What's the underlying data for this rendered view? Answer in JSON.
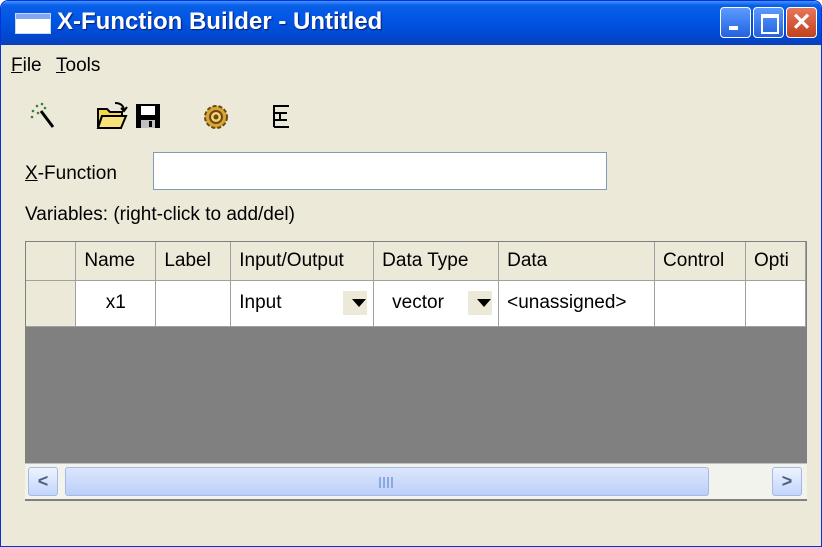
{
  "window": {
    "title": "X-Function Builder - Untitled",
    "controls": {
      "minimize": "minimize",
      "maximize": "maximize",
      "close": "✕"
    }
  },
  "menu": {
    "items": [
      {
        "label": "File",
        "accel": "F",
        "rest": "ile"
      },
      {
        "label": "Tools",
        "accel": "T",
        "rest": "ools"
      }
    ]
  },
  "toolbar": {
    "icons": [
      "new-wand-icon",
      "open-folder-icon",
      "save-disk-icon",
      "compile-gear-icon",
      "tree-view-icon"
    ]
  },
  "form": {
    "xfunction_label": "X-Function",
    "xfunction_accel": "X",
    "xfunction_rest": "-Function",
    "xfunction_value": "",
    "variables_label": "Variables: (right-click to add/del)"
  },
  "grid": {
    "columns": [
      "Name",
      "Label",
      "Input/Output",
      "Data Type",
      "Data",
      "Control",
      "Opti"
    ],
    "rows": [
      {
        "name": "x1",
        "label": "",
        "io": "Input",
        "datatype": "vector",
        "data": "<unassigned>",
        "control": "",
        "option": ""
      }
    ]
  },
  "colors": {
    "titlebar": "#0054e3",
    "window_bg": "#ece9d8",
    "grid_empty": "#808080",
    "close_button": "#c1411d"
  }
}
